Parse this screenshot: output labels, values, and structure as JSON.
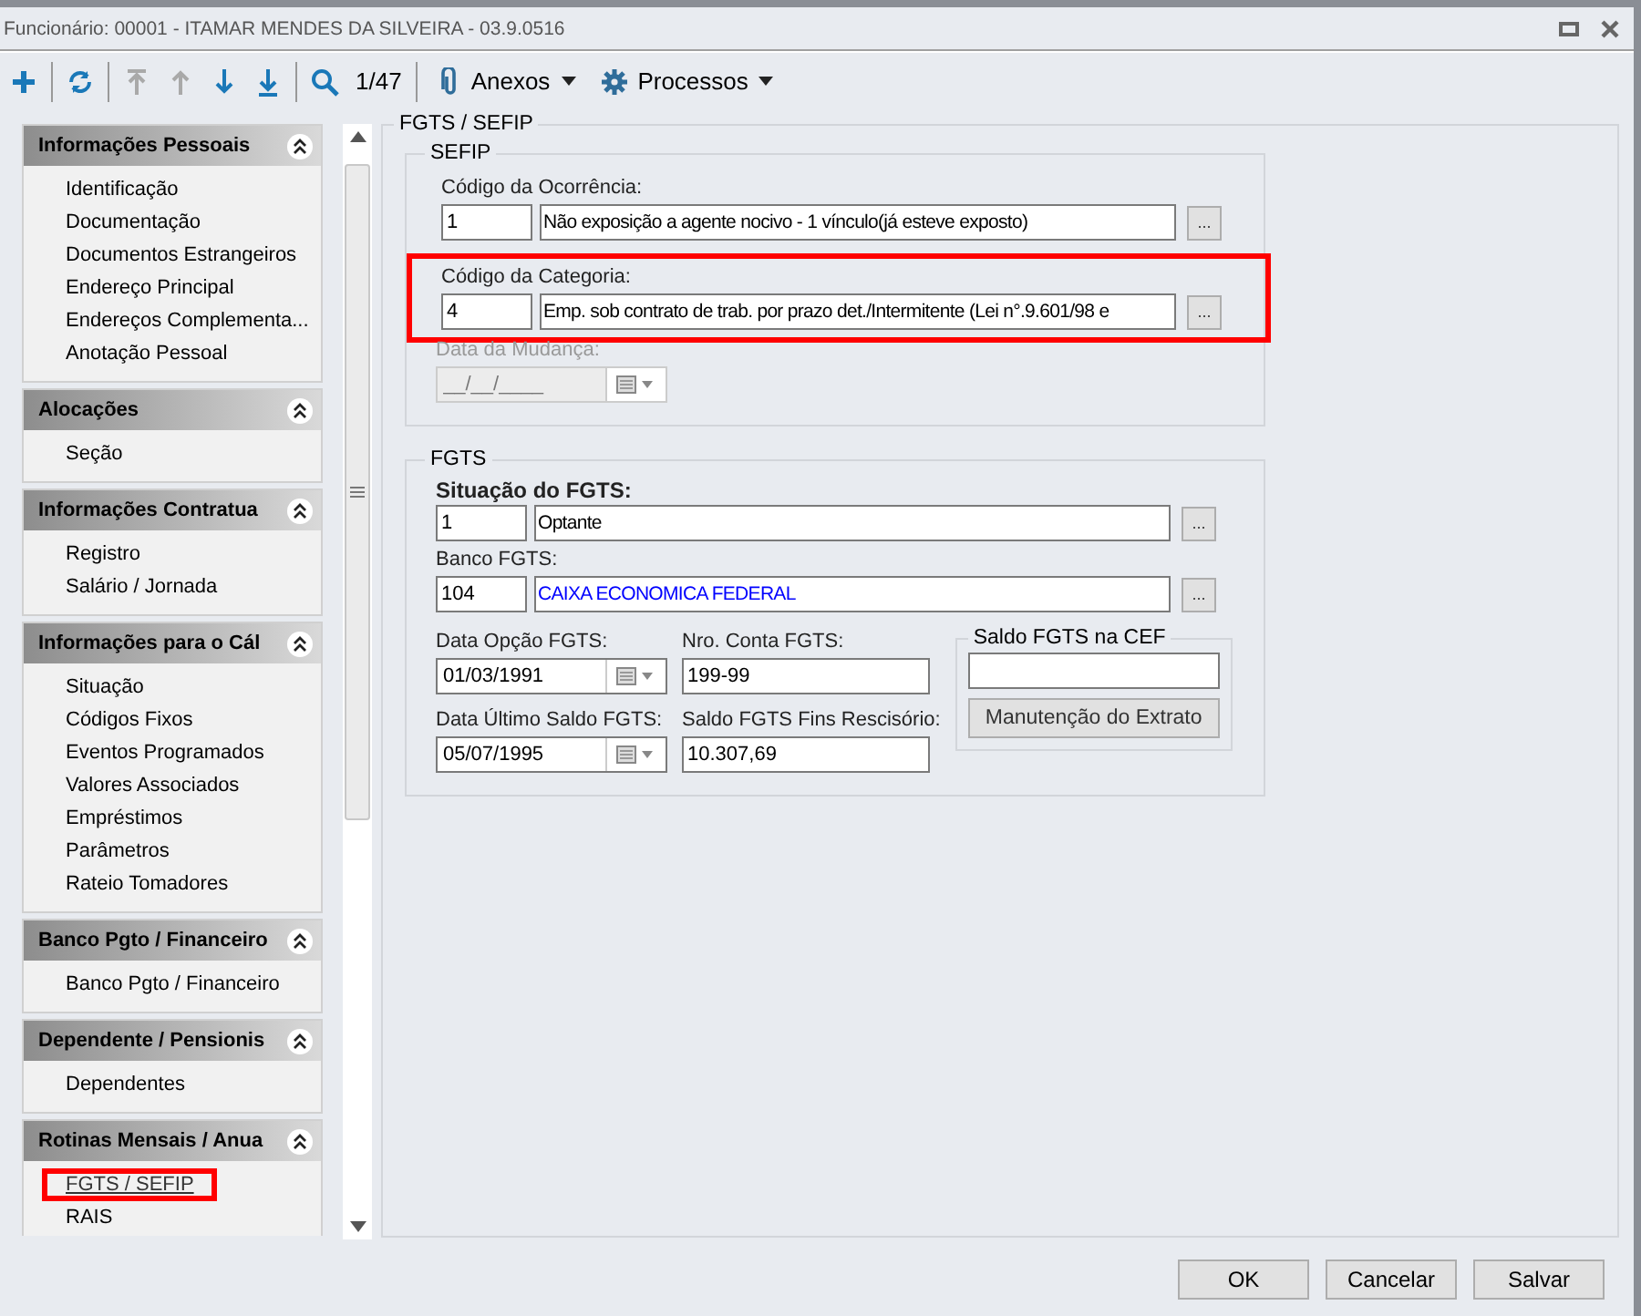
{
  "window": {
    "title": "Funcionário: 00001 - ITAMAR MENDES DA SILVEIRA - 03.9.0516"
  },
  "toolbar": {
    "record_counter": "1/47",
    "menus": [
      {
        "kind": "clip",
        "label": "Anexos"
      },
      {
        "kind": "gear",
        "label": "Processos"
      }
    ],
    "tools": [
      {
        "kind": "add",
        "disabled": false
      },
      {
        "kind": "refresh",
        "disabled": false
      },
      {
        "kind": "first",
        "disabled": true
      },
      {
        "kind": "up",
        "disabled": true
      },
      {
        "kind": "down",
        "disabled": false
      },
      {
        "kind": "last",
        "disabled": false
      },
      {
        "kind": "search",
        "disabled": false
      }
    ]
  },
  "sidebar": {
    "sections": [
      {
        "title": "Informações Pessoais",
        "items": [
          {
            "label": "Identificação",
            "selected": false
          },
          {
            "label": "Documentação",
            "selected": false
          },
          {
            "label": "Documentos Estrangeiros",
            "selected": false
          },
          {
            "label": "Endereço Principal",
            "selected": false
          },
          {
            "label": "Endereços Complementa...",
            "selected": false
          },
          {
            "label": "Anotação Pessoal",
            "selected": false
          }
        ]
      },
      {
        "title": "Alocações",
        "items": [
          {
            "label": "Seção",
            "selected": false
          }
        ]
      },
      {
        "title": "Informações Contratua",
        "items": [
          {
            "label": "Registro",
            "selected": false
          },
          {
            "label": "Salário / Jornada",
            "selected": false
          }
        ]
      },
      {
        "title": "Informações para o Cál",
        "items": [
          {
            "label": "Situação",
            "selected": false
          },
          {
            "label": "Códigos Fixos",
            "selected": false
          },
          {
            "label": "Eventos Programados",
            "selected": false
          },
          {
            "label": "Valores Associados",
            "selected": false
          },
          {
            "label": "Empréstimos",
            "selected": false
          },
          {
            "label": "Parâmetros",
            "selected": false
          },
          {
            "label": "Rateio Tomadores",
            "selected": false
          }
        ]
      },
      {
        "title": "Banco Pgto / Financeiro",
        "items": [
          {
            "label": "Banco Pgto / Financeiro",
            "selected": false
          }
        ]
      },
      {
        "title": "Dependente / Pensionis",
        "items": [
          {
            "label": "Dependentes",
            "selected": false
          }
        ]
      },
      {
        "title": "Rotinas Mensais / Anua",
        "items": [
          {
            "label": "FGTS / SEFIP",
            "selected": true
          },
          {
            "label": "RAIS",
            "selected": false
          }
        ]
      }
    ]
  },
  "main": {
    "title": "FGTS / SEFIP",
    "sefip": {
      "title": "SEFIP",
      "lookups": [
        {
          "label": "Código da Ocorrência:",
          "code": "1",
          "description": "Não exposição a agente nocivo - 1 vínculo(já esteve exposto)",
          "button": "...",
          "highlighted": false
        },
        {
          "label": "Código da Categoria:",
          "code": "4",
          "description": "Emp. sob contrato de trab. por prazo det./Intermitente (Lei n°.9.601/98 e",
          "button": "...",
          "highlighted": true
        }
      ],
      "change_date": {
        "label": "Data da Mudança:",
        "placeholder": "__/__/____",
        "disabled": true
      }
    },
    "fgts": {
      "title": "FGTS",
      "lookups": [
        {
          "label": "Situação do FGTS:",
          "bold": true,
          "code": "1",
          "description": "Optante",
          "button": "...",
          "link": false
        },
        {
          "label": "Banco FGTS:",
          "bold": false,
          "code": "104",
          "description": "CAIXA ECONOMICA FEDERAL",
          "button": "...",
          "link": true
        }
      ],
      "option_date": {
        "label": "Data Opção FGTS:",
        "value": "01/03/1991",
        "disabled": false
      },
      "account": {
        "label": "Nro. Conta FGTS:",
        "value": "199-99"
      },
      "last_balance_date": {
        "label": "Data Último Saldo FGTS:",
        "value": "05/07/1995",
        "disabled": false
      },
      "termination_balance": {
        "label": "Saldo FGTS Fins Rescisório:",
        "value": "10.307,69"
      },
      "cef_balance": {
        "title": "Saldo FGTS na CEF",
        "button": "Manutenção do Extrato"
      }
    }
  },
  "footer": {
    "buttons": [
      "OK",
      "Cancelar",
      "Salvar"
    ]
  }
}
